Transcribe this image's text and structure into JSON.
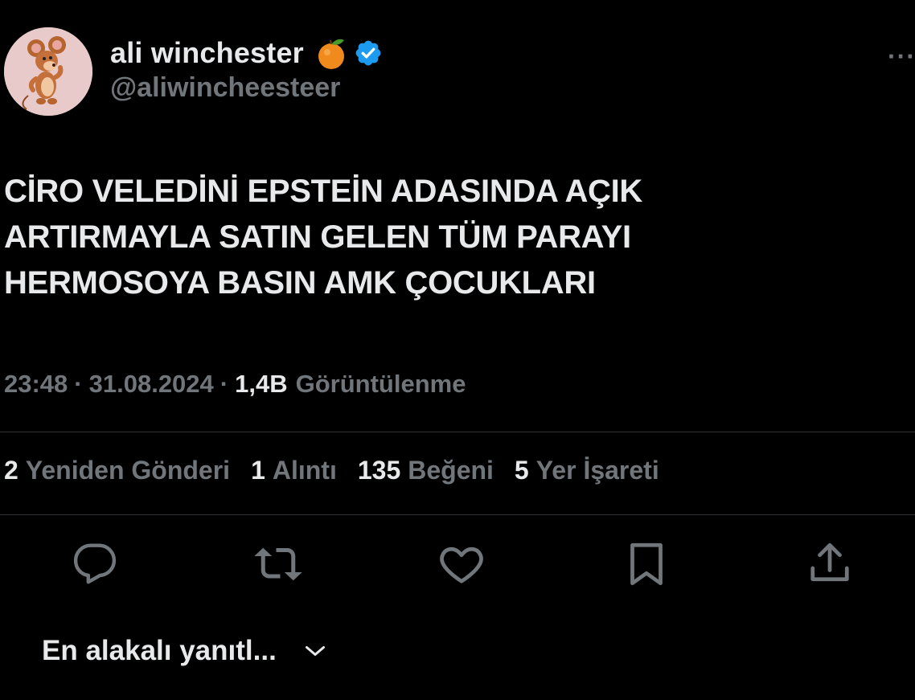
{
  "author": {
    "name": "ali winchester",
    "handle": "@aliwincheesteer",
    "name_emoji": "orange-icon",
    "verified": true,
    "verified_color": "#1d9bf0"
  },
  "tweet": {
    "text": "CİRO VELEDİNİ EPSTEİN ADASINDA AÇIK\nARTIRMAYLA SATIN GELEN TÜM PARAYI\nHERMOSOYA BASIN AMK ÇOCUKLARI"
  },
  "meta": {
    "time": "23:48",
    "separator": "·",
    "date": "31.08.2024",
    "views_count": "1,4B",
    "views_label": "Görüntülenme"
  },
  "stats": {
    "reposts": {
      "count": "2",
      "label": "Yeniden Gönderi"
    },
    "quotes": {
      "count": "1",
      "label": "Alıntı"
    },
    "likes": {
      "count": "135",
      "label": "Beğeni"
    },
    "bookmarks": {
      "count": "5",
      "label": "Yer İşareti"
    }
  },
  "actions": [
    "reply-icon",
    "repost-icon",
    "like-icon",
    "bookmark-icon",
    "share-icon"
  ],
  "more_menu": "···",
  "replies_sort": {
    "label": "En alakalı yanıtl..."
  },
  "colors": {
    "background": "#000000",
    "text_primary": "#e7e9ea",
    "text_secondary": "#71767b",
    "divider": "#2f3336"
  }
}
